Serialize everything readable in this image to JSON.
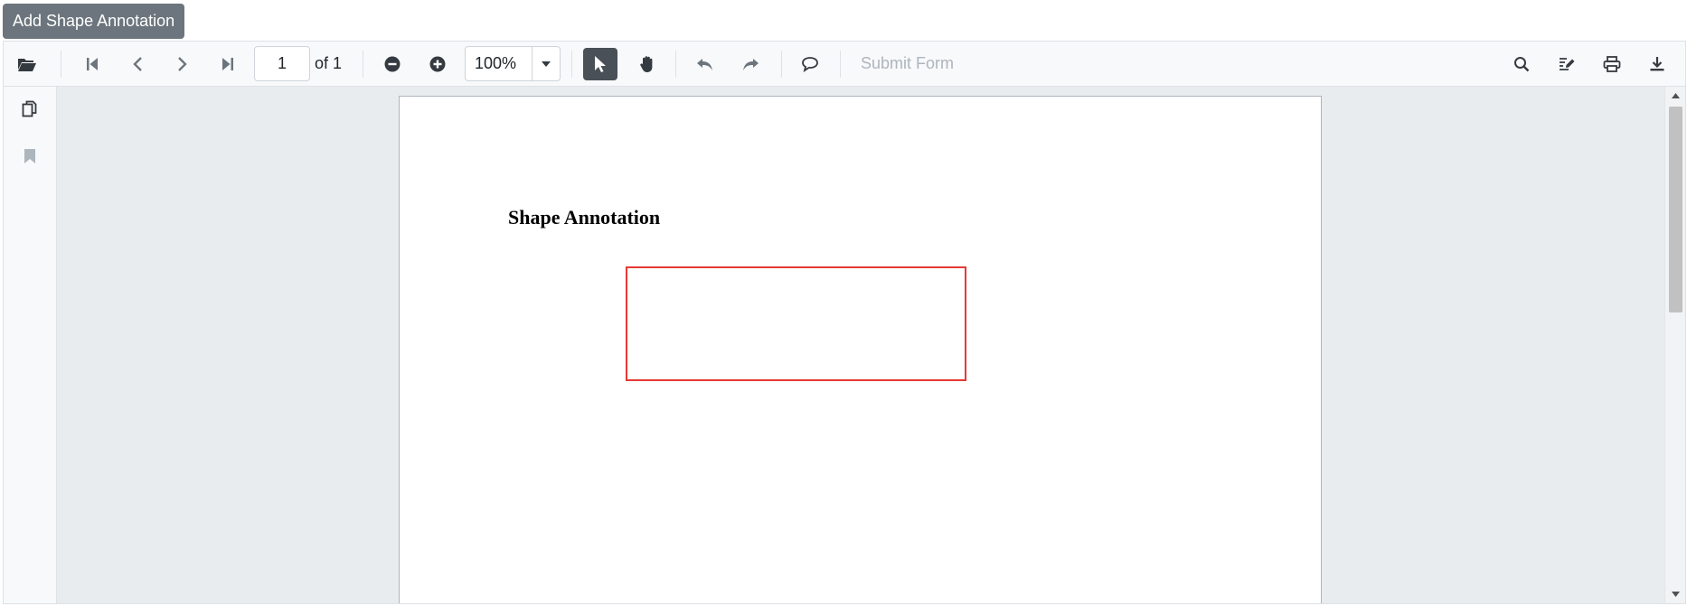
{
  "top_button": {
    "label": "Add Shape Annotation"
  },
  "toolbar": {
    "page_number": "1",
    "page_of": "of 1",
    "zoom_value": "100%",
    "submit_form": "Submit Form",
    "icons": [
      "open-folder-icon",
      "first-page-icon",
      "previous-page-icon",
      "next-page-icon",
      "last-page-icon",
      "zoom-out-icon",
      "zoom-in-icon",
      "dropdown-caret-icon",
      "selection-pointer-icon",
      "pan-hand-icon",
      "undo-icon",
      "redo-icon",
      "comment-icon",
      "search-icon",
      "annotation-edit-icon",
      "print-icon",
      "download-icon"
    ]
  },
  "sidebar": {
    "icons": [
      "page-thumbnails-icon",
      "bookmark-icon"
    ]
  },
  "document": {
    "heading": "Shape Annotation",
    "annotation_color": "#e53935"
  },
  "colors": {
    "toolbar_bg": "#f8f9fa",
    "viewer_bg": "#e9ecef",
    "active_tool": "#495057",
    "primary_button": "#6c757d"
  }
}
